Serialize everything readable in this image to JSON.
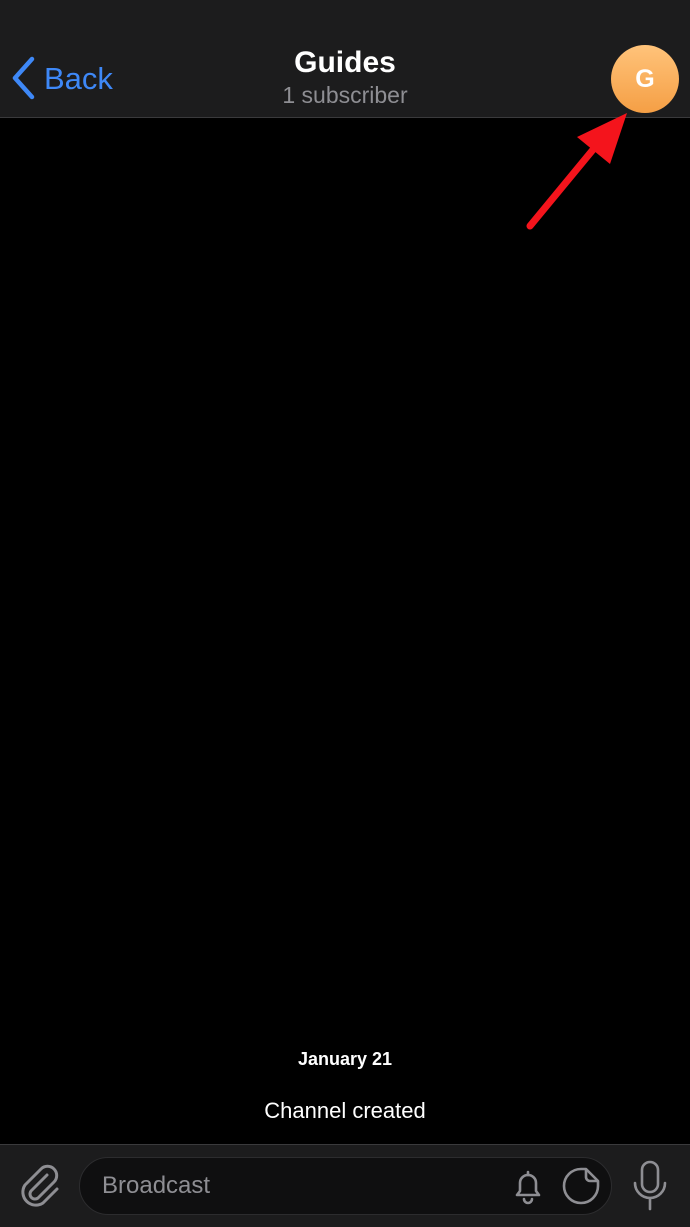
{
  "header": {
    "back_label": "Back",
    "title": "Guides",
    "subtitle": "1 subscriber",
    "avatar_letter": "G"
  },
  "chat": {
    "date": "January 21",
    "service_message": "Channel created"
  },
  "input_bar": {
    "placeholder": "Broadcast"
  },
  "icons": {
    "back": "chevron-left-icon",
    "attach": "paperclip-icon",
    "bell": "bell-icon",
    "sticker": "sticker-icon",
    "mic": "microphone-icon",
    "annotation": "red-arrow-icon"
  },
  "colors": {
    "accent": "#3e88f7",
    "avatar_top": "#ffc37a",
    "avatar_bottom": "#f59f45",
    "annotation": "#f4141c",
    "bar_background": "#1c1c1d",
    "secondary_text": "#8e8e93"
  }
}
